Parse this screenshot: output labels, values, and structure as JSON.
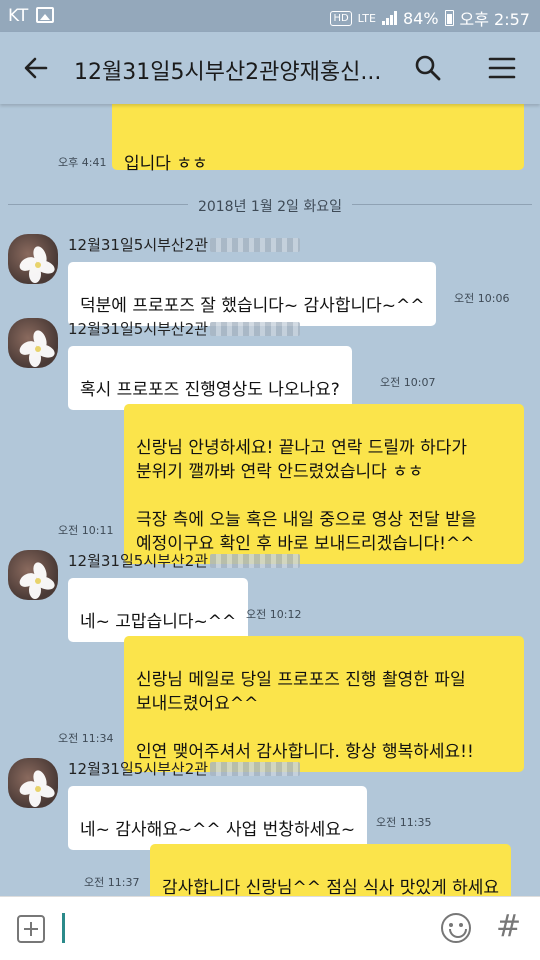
{
  "status_bar": {
    "carrier": "KT",
    "network": "LTE",
    "battery": "84%",
    "time": "오후 2:57"
  },
  "header": {
    "title": "12월31일5시부산2관양재홍신..."
  },
  "messages": {
    "m0": {
      "text": "입니다 ㅎㅎ",
      "time": "오후 4:41"
    },
    "date_divider": "2018년 1월 2일 화요일",
    "m1": {
      "sender": "12월31일5시부산2관",
      "text": "덕분에 프로포즈 잘 했습니다~ 감사합니다~^^",
      "time": "오전 10:06"
    },
    "m2": {
      "sender": "12월31일5시부산2관",
      "text": "혹시 프로포즈 진행영상도 나오나요?",
      "time": "오전 10:07"
    },
    "m3": {
      "text": "신랑님 안녕하세요! 끝나고 연락 드릴까 하다가\n분위기 깰까봐 연락 안드렸었습니다 ㅎㅎ\n\n극장 측에 오늘 혹은 내일 중으로 영상 전달 받을\n예정이구요 확인 후 바로 보내드리겠습니다!^^",
      "time": "오전 10:11"
    },
    "m4": {
      "sender": "12월31일5시부산2관",
      "text": "네~ 고맙습니다~^^",
      "time": "오전 10:12"
    },
    "m5": {
      "text": "신랑님 메일로 당일 프로포즈 진행 촬영한 파일\n보내드렸어요^^\n\n인연 맺어주셔서 감사합니다. 항상 행복하세요!!",
      "time": "오전 11:34"
    },
    "m6": {
      "sender": "12월31일5시부산2관",
      "text": "네~ 감사해요~^^ 사업 번창하세요~",
      "time": "오전 11:35"
    },
    "m7": {
      "text": "감사합니다 신랑님^^ 점심 식사 맛있게 하세요",
      "time": "오전 11:37"
    }
  },
  "input": {
    "value": "",
    "hash_symbol": "#"
  },
  "colors": {
    "background": "#b2c7d9",
    "my_bubble": "#fbe44b",
    "their_bubble": "#ffffff"
  },
  "icons": [
    "back-arrow-icon",
    "search-icon",
    "menu-icon",
    "plus-icon",
    "emoji-icon",
    "hash-icon"
  ]
}
